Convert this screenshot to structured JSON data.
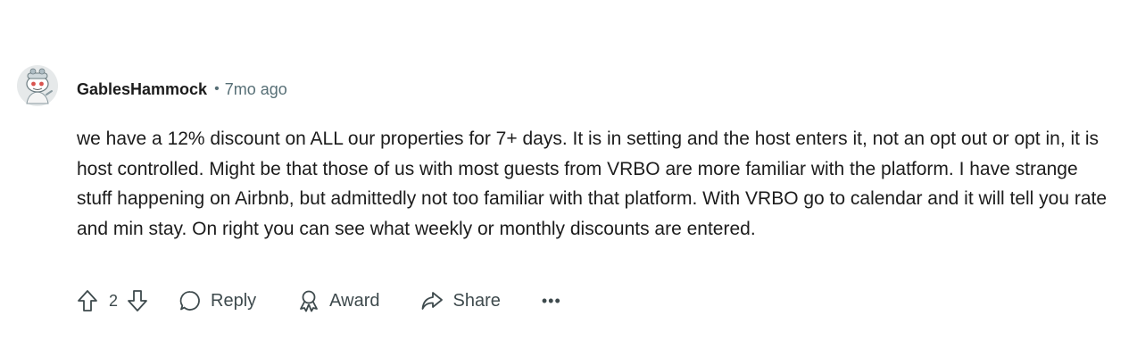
{
  "comment": {
    "author": "GablesHammock",
    "separator": "•",
    "time_ago": "7mo ago",
    "avatar_icon": "snoo-avatar-icon",
    "body": "we have a 12% discount on ALL our properties for 7+ days. It is in setting and the host enters it, not an opt out or opt in, it is host controlled. Might be that those of us with most guests from VRBO are more familiar with the platform. I have strange stuff happening on Airbnb, but admittedly not too familiar with that platform. With VRBO go to calendar and it will tell you rate and min stay. On right you can see what weekly or monthly discounts are entered."
  },
  "actions": {
    "upvote_icon": "upvote-arrow-icon",
    "score": "2",
    "downvote_icon": "downvote-arrow-icon",
    "reply_label": "Reply",
    "reply_icon": "speech-bubble-icon",
    "award_label": "Award",
    "award_icon": "award-ribbon-icon",
    "share_label": "Share",
    "share_icon": "share-arrow-icon",
    "more_label": "•••",
    "more_icon": "overflow-dots-icon"
  },
  "colors": {
    "text": "#1c1c1c",
    "muted": "#576f76",
    "action": "#3e4a4d",
    "background": "#ffffff"
  }
}
